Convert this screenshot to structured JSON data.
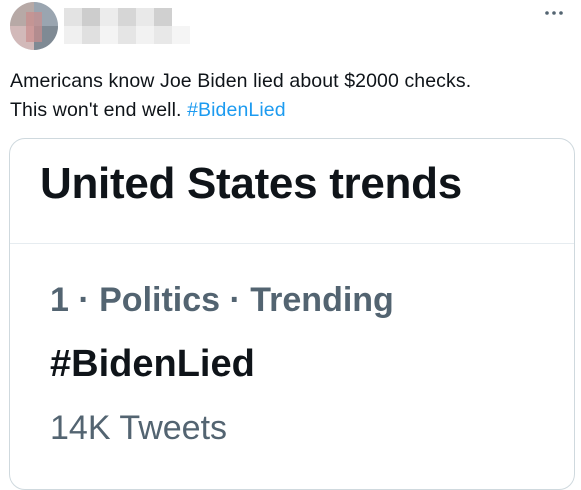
{
  "header": {
    "more_icon": "ellipsis-icon"
  },
  "tweet": {
    "line1": "Americans know Joe Biden lied about $2000 checks.",
    "line2_text": "This won't end well. ",
    "hashtag": "#BidenLied"
  },
  "card": {
    "title": "United States trends",
    "trend": {
      "meta": "1 · Politics · Trending",
      "name": "#BidenLied",
      "count": "14K Tweets"
    }
  },
  "colors": {
    "link": "#1d9bf0",
    "secondary_text": "#536471",
    "primary_text": "#0f1419",
    "border": "#cfd9de"
  }
}
